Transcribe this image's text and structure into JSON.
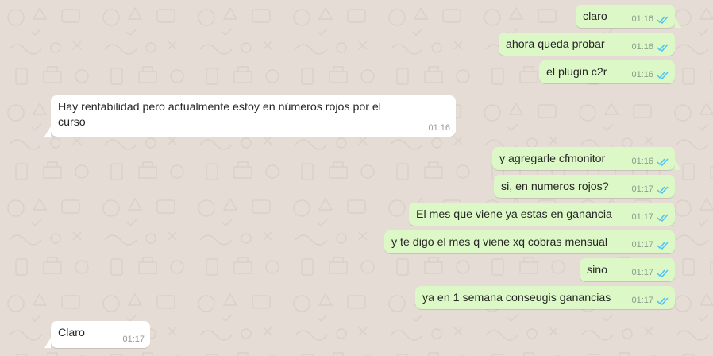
{
  "colors": {
    "outgoing_bubble": "#dcf8c6",
    "incoming_bubble": "#ffffff",
    "chat_background": "#e5ddd5",
    "read_ticks": "#4fc3f7"
  },
  "icons": {
    "read_receipt": "double-check-icon"
  },
  "messages": [
    {
      "direction": "out",
      "text": "claro",
      "time": "01:16",
      "status": "read"
    },
    {
      "direction": "out",
      "text": "ahora queda probar",
      "time": "01:16",
      "status": "read"
    },
    {
      "direction": "out",
      "text": "el plugin c2r",
      "time": "01:16",
      "status": "read"
    },
    {
      "direction": "in",
      "text": "Hay rentabilidad pero actualmente estoy en números rojos por el curso",
      "time": "01:16"
    },
    {
      "direction": "out",
      "text": "y agregarle cfmonitor",
      "time": "01:16",
      "status": "read"
    },
    {
      "direction": "out",
      "text": "si, en numeros rojos?",
      "time": "01:17",
      "status": "read"
    },
    {
      "direction": "out",
      "text": "El mes que viene ya estas en ganancia",
      "time": "01:17",
      "status": "read"
    },
    {
      "direction": "out",
      "text": "y te digo el mes q viene xq cobras mensual",
      "time": "01:17",
      "status": "read"
    },
    {
      "direction": "out",
      "text": "sino",
      "time": "01:17",
      "status": "read"
    },
    {
      "direction": "out",
      "text": "ya en 1 semana conseugis ganancias",
      "time": "01:17",
      "status": "read"
    },
    {
      "direction": "in",
      "text": "Claro",
      "time": "01:17"
    }
  ]
}
